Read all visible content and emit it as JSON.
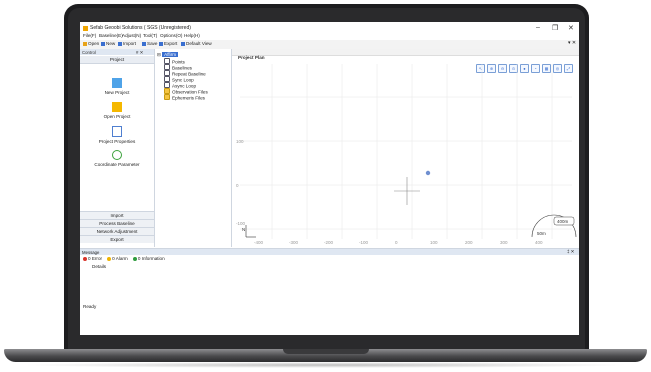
{
  "app": {
    "title": "Sefab Geoobi Solutions ( SGS (Unregistered)",
    "window_controls": [
      "–",
      "❐",
      "✕"
    ]
  },
  "menu": [
    "File(F)",
    "Baseline(E)",
    "Adjust(N)",
    "Tool(T)",
    "Options(O)",
    "Help(H)"
  ],
  "toolbar": [
    {
      "label": "Open",
      "icon": "folder-icon",
      "color": "#e8a317"
    },
    {
      "label": "New",
      "icon": "new-file-icon",
      "color": "#3a6fd0"
    },
    {
      "label": "Import",
      "icon": "import-icon",
      "color": "#3a6fd0"
    },
    {
      "label": "Save",
      "icon": "save-icon",
      "color": "#3a6fd0"
    },
    {
      "label": "Export",
      "icon": "export-icon",
      "color": "#3a6fd0"
    },
    {
      "label": "Default View",
      "icon": "view-icon",
      "color": "#3a6fd0"
    }
  ],
  "control_panel": {
    "title": "Control",
    "pin": "# ✕",
    "tab": "Project",
    "tools": [
      {
        "label": "New Project",
        "icon": "new-project-icon",
        "color": "#4fa3e8"
      },
      {
        "label": "Open Project",
        "icon": "open-project-icon",
        "color": "#f5b800"
      },
      {
        "label": "Project Properties",
        "icon": "properties-icon",
        "color": "#4f7fd0"
      },
      {
        "label": "Coordinate Parameter",
        "icon": "globe-icon",
        "color": "#3ca23c"
      }
    ],
    "bottom_tabs": [
      "Import",
      "Process Baseline",
      "Network Adjustment",
      "Export"
    ]
  },
  "tree": {
    "root": "Affirm",
    "items": [
      "Points",
      "Baselines",
      "Repeat Baseline",
      "Sync Loop",
      "Async Loop",
      "Observation Files",
      "Ephemeris Files"
    ]
  },
  "plot": {
    "tab_title": "Project Plan",
    "tools": [
      "↖",
      "⊕",
      "⊖",
      "⊙",
      "●",
      "◔",
      "▦",
      "◎",
      "⤢"
    ],
    "y_ticks": [
      "100",
      "0",
      "-100"
    ],
    "x_ticks": [
      "-500",
      "-400",
      "-300",
      "-200",
      "-100",
      "0",
      "100",
      "200",
      "300",
      "400"
    ],
    "scale_label": "400m",
    "scale_small": "50m",
    "north": "N"
  },
  "messages": {
    "title": "Message",
    "error_label": "0 Error",
    "alarm_label": "0 Alarm",
    "info_label": "0 Information",
    "column": "Details",
    "error_color": "#d9342b",
    "alarm_color": "#f0b400",
    "info_color": "#2e9c3e"
  },
  "status": "Ready"
}
